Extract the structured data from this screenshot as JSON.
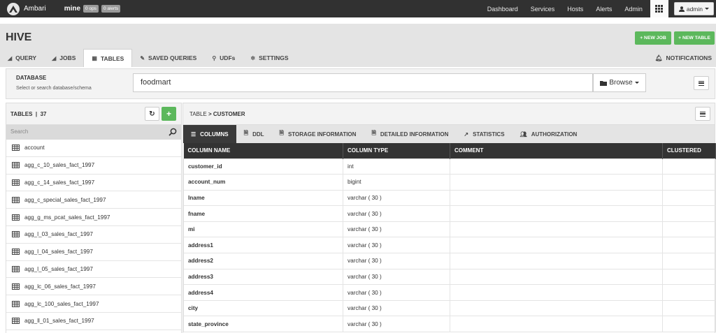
{
  "topbar": {
    "brand": "Ambari",
    "cluster": "mine",
    "ops_badge": "0 ops",
    "alerts_badge": "0 alerts",
    "nav": [
      "Dashboard",
      "Services",
      "Hosts",
      "Alerts",
      "Admin"
    ],
    "user": "admin"
  },
  "header": {
    "title": "HIVE",
    "new_job": "+ NEW JOB",
    "new_table": "+ NEW TABLE",
    "tabs": [
      {
        "label": "QUERY",
        "icon": "paper-plane-icon"
      },
      {
        "label": "JOBS",
        "icon": "paper-plane-icon"
      },
      {
        "label": "TABLES",
        "icon": "table-icon"
      },
      {
        "label": "SAVED QUERIES",
        "icon": "paperclip-icon"
      },
      {
        "label": "UDFs",
        "icon": "plug-icon"
      },
      {
        "label": "SETTINGS",
        "icon": "gear-icon"
      }
    ],
    "notifications": "NOTIFICATIONS"
  },
  "database": {
    "label": "DATABASE",
    "hint": "Select or search database/schema",
    "value": "foodmart",
    "browse": "Browse"
  },
  "tables_panel": {
    "title": "TABLES",
    "count": "37",
    "search_placeholder": "Search",
    "items": [
      "account",
      "agg_c_10_sales_fact_1997",
      "agg_c_14_sales_fact_1997",
      "agg_c_special_sales_fact_1997",
      "agg_g_ms_pcat_sales_fact_1997",
      "agg_l_03_sales_fact_1997",
      "agg_l_04_sales_fact_1997",
      "agg_l_05_sales_fact_1997",
      "agg_lc_06_sales_fact_1997",
      "agg_lc_100_sales_fact_1997",
      "agg_ll_01_sales_fact_1997"
    ]
  },
  "detail": {
    "crumb_table": "TABLE",
    "crumb_sep": ">",
    "crumb_name": "CUSTOMER",
    "tabs": [
      {
        "label": "COLUMNS",
        "icon": "list-icon"
      },
      {
        "label": "DDL",
        "icon": "file-icon"
      },
      {
        "label": "STORAGE INFORMATION",
        "icon": "file-icon"
      },
      {
        "label": "DETAILED INFORMATION",
        "icon": "file-icon"
      },
      {
        "label": "STATISTICS",
        "icon": "chart-icon"
      },
      {
        "label": "AUTHORIZATION",
        "icon": "users-icon"
      }
    ],
    "columns_header": [
      "COLUMN NAME",
      "COLUMN TYPE",
      "COMMENT",
      "CLUSTERED"
    ],
    "rows": [
      [
        "customer_id",
        "int"
      ],
      [
        "account_num",
        "bigint"
      ],
      [
        "lname",
        "varchar ( 30 )"
      ],
      [
        "fname",
        "varchar ( 30 )"
      ],
      [
        "mi",
        "varchar ( 30 )"
      ],
      [
        "address1",
        "varchar ( 30 )"
      ],
      [
        "address2",
        "varchar ( 30 )"
      ],
      [
        "address3",
        "varchar ( 30 )"
      ],
      [
        "address4",
        "varchar ( 30 )"
      ],
      [
        "city",
        "varchar ( 30 )"
      ],
      [
        "state_province",
        "varchar ( 30 )"
      ]
    ]
  },
  "colors": {
    "topbar": "#313131",
    "header": "#e4e4e4",
    "green": "#5cb85c",
    "table_header": "#333333"
  }
}
